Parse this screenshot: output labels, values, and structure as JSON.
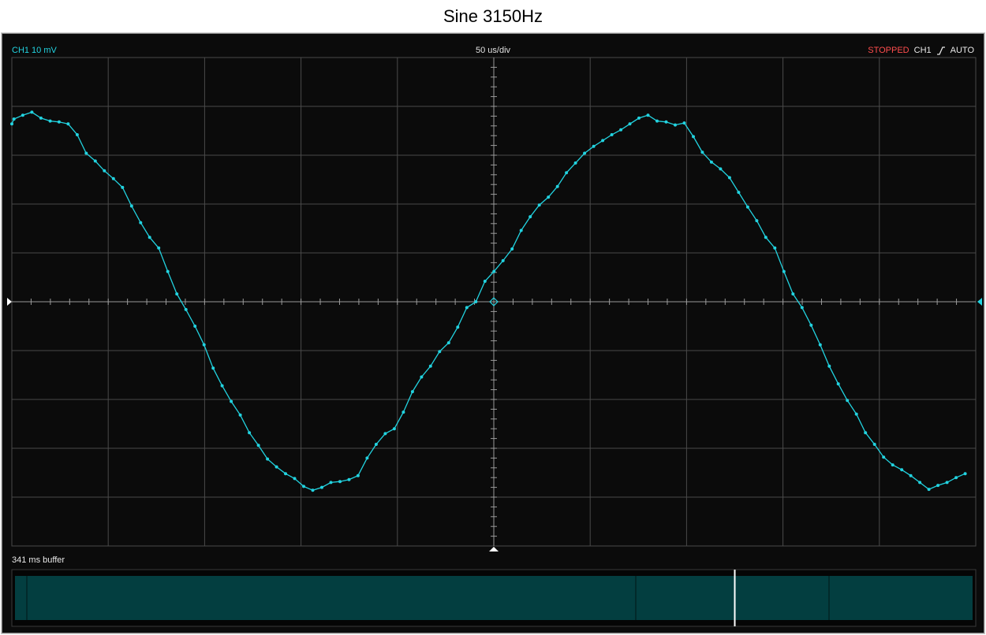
{
  "window": {
    "title": "Sine 3150Hz"
  },
  "header": {
    "channel_scale": "CH1 10 mV",
    "timebase": "50 us/div",
    "run_state": "STOPPED",
    "trigger_channel": "CH1",
    "trigger_mode": "AUTO",
    "trigger_edge_icon": "rising-edge-icon"
  },
  "buffer": {
    "label": "341 ms buffer",
    "cursor_position": 0.75
  },
  "colors": {
    "trace": "#22d3e0",
    "background": "#0b0b0b",
    "grid": "#4a4a4a",
    "stopped": "#ff4d4d",
    "buffer_fill": "#033e40"
  },
  "chart_data": {
    "type": "line",
    "title": "",
    "xlabel": "",
    "ylabel": "",
    "x_unit": "us",
    "y_unit": "mV",
    "x_range": [
      -250,
      250
    ],
    "y_range": [
      -25,
      25
    ],
    "x_divisions": 10,
    "y_divisions": 10,
    "grid": true,
    "series": [
      {
        "values": [
          [
            -250,
            18.2
          ],
          [
            -248.9,
            18.7
          ],
          [
            -244.3,
            19.1
          ],
          [
            -239.6,
            19.4
          ],
          [
            -234.9,
            18.8
          ],
          [
            -230.1,
            18.5
          ],
          [
            -225.5,
            18.4
          ],
          [
            -220.8,
            18.2
          ],
          [
            -216.1,
            17.1
          ],
          [
            -211.4,
            15.2
          ],
          [
            -206.7,
            14.4
          ],
          [
            -202.0,
            13.4
          ],
          [
            -197.3,
            12.6
          ],
          [
            -192.6,
            11.7
          ],
          [
            -187.9,
            9.8
          ],
          [
            -183.2,
            8.1
          ],
          [
            -178.5,
            6.6
          ],
          [
            -173.8,
            5.5
          ],
          [
            -169.1,
            3.1
          ],
          [
            -164.4,
            0.8
          ],
          [
            -159.7,
            -0.8
          ],
          [
            -155.0,
            -2.5
          ],
          [
            -150.3,
            -4.4
          ],
          [
            -145.6,
            -6.8
          ],
          [
            -140.9,
            -8.6
          ],
          [
            -136.2,
            -10.2
          ],
          [
            -131.5,
            -11.6
          ],
          [
            -126.8,
            -13.4
          ],
          [
            -122.1,
            -14.7
          ],
          [
            -117.4,
            -16.1
          ],
          [
            -112.7,
            -16.9
          ],
          [
            -108.0,
            -17.6
          ],
          [
            -103.3,
            -18.1
          ],
          [
            -98.6,
            -18.9
          ],
          [
            -93.9,
            -19.3
          ],
          [
            -89.2,
            -19.0
          ],
          [
            -84.5,
            -18.5
          ],
          [
            -79.8,
            -18.4
          ],
          [
            -75.1,
            -18.2
          ],
          [
            -70.4,
            -17.8
          ],
          [
            -65.7,
            -16.0
          ],
          [
            -61.0,
            -14.6
          ],
          [
            -56.3,
            -13.5
          ],
          [
            -51.6,
            -13.0
          ],
          [
            -46.9,
            -11.3
          ],
          [
            -42.2,
            -9.2
          ],
          [
            -37.5,
            -7.7
          ],
          [
            -32.8,
            -6.6
          ],
          [
            -28.1,
            -5.1
          ],
          [
            -23.4,
            -4.2
          ],
          [
            -18.7,
            -2.6
          ],
          [
            -14.0,
            -0.6
          ],
          [
            -9.3,
            0.0
          ],
          [
            -4.6,
            2.1
          ],
          [
            0.1,
            3.1
          ],
          [
            4.8,
            4.2
          ],
          [
            9.5,
            5.4
          ],
          [
            14.2,
            7.3
          ],
          [
            18.9,
            8.7
          ],
          [
            23.6,
            9.9
          ],
          [
            28.3,
            10.7
          ],
          [
            33.0,
            11.8
          ],
          [
            37.7,
            13.2
          ],
          [
            42.4,
            14.2
          ],
          [
            47.1,
            15.2
          ],
          [
            51.8,
            15.9
          ],
          [
            56.5,
            16.5
          ],
          [
            61.2,
            17.1
          ],
          [
            65.9,
            17.6
          ],
          [
            70.6,
            18.2
          ],
          [
            75.3,
            18.8
          ],
          [
            80.0,
            19.1
          ],
          [
            84.7,
            18.5
          ],
          [
            89.4,
            18.4
          ],
          [
            94.1,
            18.1
          ],
          [
            98.8,
            18.3
          ],
          [
            103.5,
            16.9
          ],
          [
            108.2,
            15.3
          ],
          [
            112.9,
            14.3
          ],
          [
            117.6,
            13.6
          ],
          [
            122.3,
            12.7
          ],
          [
            127.0,
            11.2
          ],
          [
            131.7,
            9.7
          ],
          [
            136.4,
            8.3
          ],
          [
            141.1,
            6.6
          ],
          [
            145.8,
            5.5
          ],
          [
            150.5,
            3.1
          ],
          [
            155.2,
            0.8
          ],
          [
            159.9,
            -0.6
          ],
          [
            164.6,
            -2.4
          ],
          [
            169.3,
            -4.4
          ],
          [
            174.0,
            -6.6
          ],
          [
            178.7,
            -8.4
          ],
          [
            183.4,
            -10.1
          ],
          [
            188.1,
            -11.5
          ],
          [
            192.8,
            -13.4
          ],
          [
            197.5,
            -14.6
          ],
          [
            202.2,
            -15.9
          ],
          [
            206.9,
            -16.7
          ],
          [
            211.6,
            -17.2
          ],
          [
            216.3,
            -17.8
          ],
          [
            221.0,
            -18.5
          ],
          [
            225.7,
            -19.2
          ],
          [
            230.4,
            -18.8
          ],
          [
            235.1,
            -18.5
          ],
          [
            239.8,
            -18.0
          ],
          [
            244.5,
            -17.6
          ]
        ]
      }
    ]
  }
}
